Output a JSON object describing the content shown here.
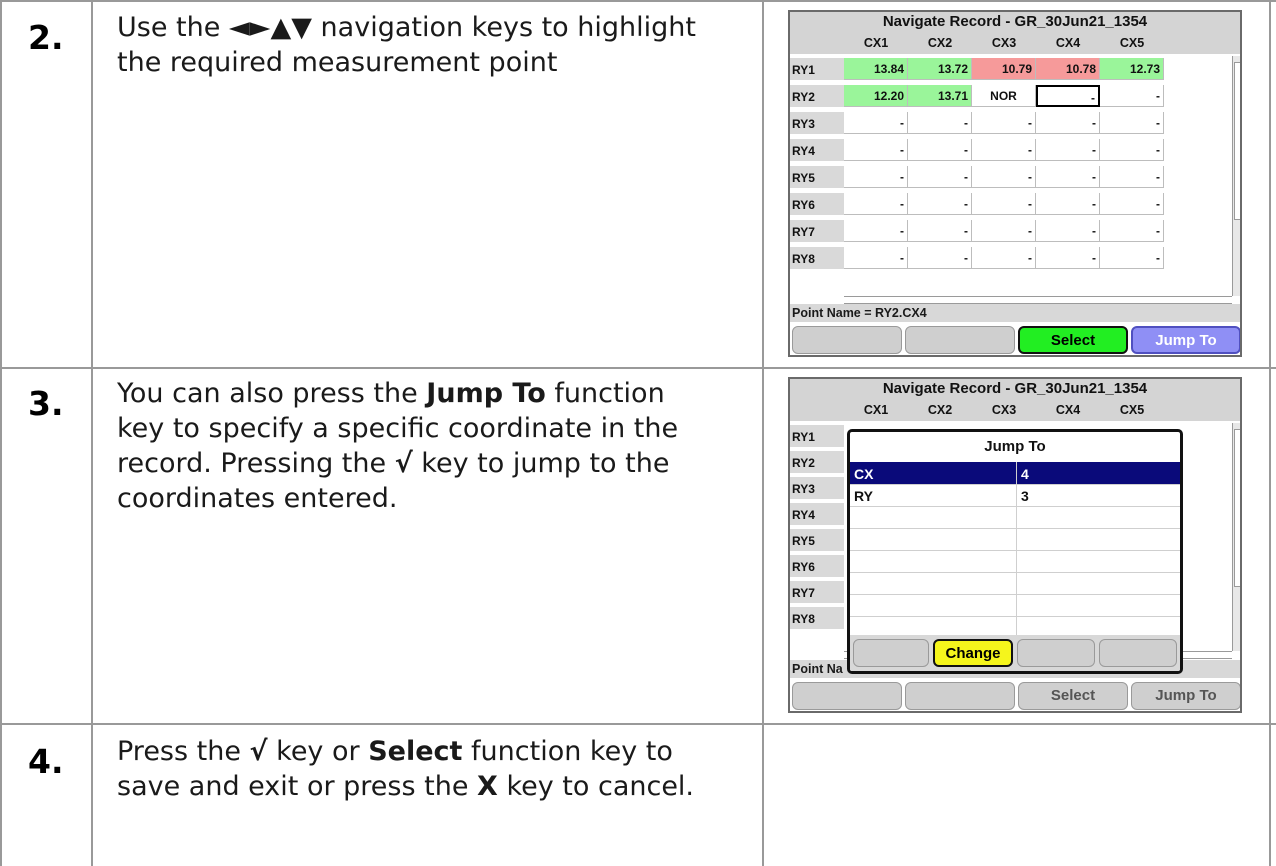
{
  "steps": [
    {
      "number": "2.",
      "text_parts": [
        "Use the ◄►▲▼ navigation keys to highlight the required measurement point"
      ]
    },
    {
      "number": "3.",
      "text_parts": [
        "You can also press the ",
        "Jump To",
        " function key to specify a specific coordinate in the record. Pressing the ",
        "√",
        " key to jump to the coordinates entered."
      ]
    },
    {
      "number": "4.",
      "text_parts": [
        "Press the ",
        "√",
        " key or ",
        "Select",
        " function key to save and exit or press the ",
        "X",
        " key to cancel."
      ]
    }
  ],
  "screen1": {
    "title": "Navigate Record - GR_30Jun21_1354",
    "columns": [
      "CX1",
      "CX2",
      "CX3",
      "CX4",
      "CX5"
    ],
    "rows": [
      {
        "label": "RY1",
        "cells": [
          {
            "value": "13.84",
            "status": "green"
          },
          {
            "value": "13.72",
            "status": "green"
          },
          {
            "value": "10.79",
            "status": "red"
          },
          {
            "value": "10.78",
            "status": "red"
          },
          {
            "value": "12.73",
            "status": "green"
          }
        ]
      },
      {
        "label": "RY2",
        "cells": [
          {
            "value": "12.20",
            "status": "green"
          },
          {
            "value": "13.71",
            "status": "green"
          },
          {
            "value": "NOR",
            "status": "nor"
          },
          {
            "value": "-",
            "status": "selected"
          },
          {
            "value": "-",
            "status": ""
          }
        ]
      },
      {
        "label": "RY3",
        "cells": [
          {
            "value": "-"
          },
          {
            "value": "-"
          },
          {
            "value": "-"
          },
          {
            "value": "-"
          },
          {
            "value": "-"
          }
        ]
      },
      {
        "label": "RY4",
        "cells": [
          {
            "value": "-"
          },
          {
            "value": "-"
          },
          {
            "value": "-"
          },
          {
            "value": "-"
          },
          {
            "value": "-"
          }
        ]
      },
      {
        "label": "RY5",
        "cells": [
          {
            "value": "-"
          },
          {
            "value": "-"
          },
          {
            "value": "-"
          },
          {
            "value": "-"
          },
          {
            "value": "-"
          }
        ]
      },
      {
        "label": "RY6",
        "cells": [
          {
            "value": "-"
          },
          {
            "value": "-"
          },
          {
            "value": "-"
          },
          {
            "value": "-"
          },
          {
            "value": "-"
          }
        ]
      },
      {
        "label": "RY7",
        "cells": [
          {
            "value": "-"
          },
          {
            "value": "-"
          },
          {
            "value": "-"
          },
          {
            "value": "-"
          },
          {
            "value": "-"
          }
        ]
      },
      {
        "label": "RY8",
        "cells": [
          {
            "value": "-"
          },
          {
            "value": "-"
          },
          {
            "value": "-"
          },
          {
            "value": "-"
          },
          {
            "value": "-"
          }
        ]
      }
    ],
    "status": "Point Name = RY2.CX4",
    "fkeys": [
      "",
      "",
      "Select",
      "Jump To"
    ]
  },
  "screen2": {
    "title": "Navigate Record - GR_30Jun21_1354",
    "columns": [
      "CX1",
      "CX2",
      "CX3",
      "CX4",
      "CX5"
    ],
    "row_labels": [
      "RY1",
      "RY2",
      "RY3",
      "RY4",
      "RY5",
      "RY6",
      "RY7",
      "RY8"
    ],
    "status": "Point Na",
    "fkeys": [
      "",
      "",
      "Select",
      "Jump To"
    ],
    "popup": {
      "title": "Jump To",
      "rows": [
        {
          "name": "CX",
          "value": "4"
        },
        {
          "name": "RY",
          "value": "3"
        },
        {
          "name": "",
          "value": ""
        },
        {
          "name": "",
          "value": ""
        },
        {
          "name": "",
          "value": ""
        },
        {
          "name": "",
          "value": ""
        },
        {
          "name": "",
          "value": ""
        },
        {
          "name": "",
          "value": ""
        }
      ],
      "fkeys": [
        "",
        "Change",
        "",
        ""
      ]
    }
  },
  "colors": {
    "green": "#9af59a",
    "red": "#f69a9a",
    "select": "#22ee22",
    "jump": "#8f8ff5",
    "change": "#f5f51c",
    "highlight": "#0a0a7a"
  }
}
